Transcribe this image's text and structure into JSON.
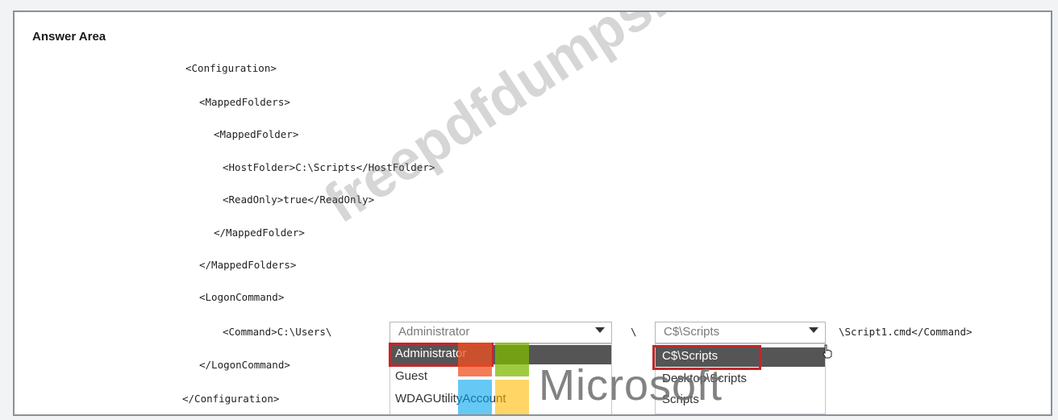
{
  "answer_area": {
    "title": "Answer Area"
  },
  "code_lines": [
    "<Configuration>",
    "<MappedFolders>",
    "<MappedFolder>",
    "<HostFolder>C:\\Scripts</HostFolder>",
    "<ReadOnly>true</ReadOnly>",
    "</MappedFolder>",
    "</MappedFolders>",
    "<LogonCommand>",
    "<Command>C:\\Users\\",
    "</LogonCommand>",
    "</Configuration>"
  ],
  "command_row": {
    "separator": "\\",
    "suffix": "\\Script1.cmd</Command>"
  },
  "dropdown_user": {
    "selected": "Administrator",
    "options": [
      "Administrator",
      "Guest",
      "WDAGUtilityAccount"
    ],
    "highlighted": "Administrator"
  },
  "dropdown_folder": {
    "selected": "C$\\Scripts",
    "options": [
      "C$\\Scripts",
      "Desktop\\Scripts",
      "Scripts"
    ],
    "highlighted": "C$\\Scripts"
  },
  "watermark": {
    "text": "freepdfdumps.com"
  },
  "brand": {
    "text": "Microsoft",
    "colors": [
      "#f25022",
      "#7fba00",
      "#00a4ef",
      "#ffb900"
    ]
  },
  "colors": {
    "highlight_border": "#c0282c",
    "selected_bg": "#555555"
  }
}
